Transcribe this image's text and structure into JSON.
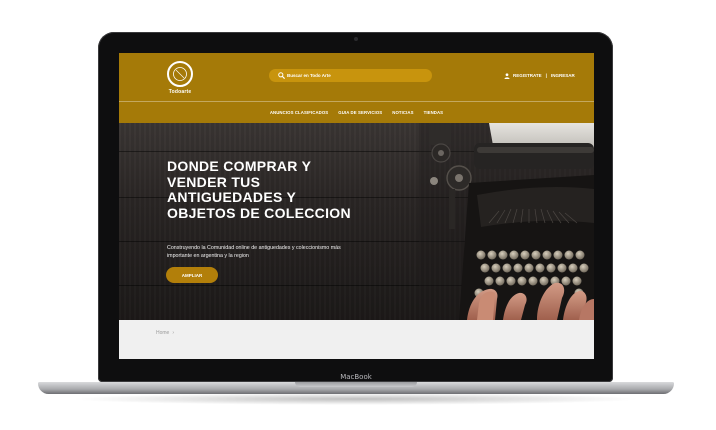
{
  "device": {
    "brand_label": "MacBook"
  },
  "header": {
    "logo_text": "Todoarte",
    "search_placeholder": "Buscar en Todo Arte",
    "register_label": "REGISTRATE",
    "separator": "|",
    "login_label": "INGRESAR",
    "accent_color": "#a57a08"
  },
  "nav": {
    "items": [
      {
        "label": "ANUNCIOS CLASIFICADOS"
      },
      {
        "label": "GUIA DE SERVICIOS"
      },
      {
        "label": "NOTICIAS"
      },
      {
        "label": "TIENDAS"
      }
    ]
  },
  "hero": {
    "title": "DONDE COMPRAR Y VENDER TUS ANTIGUEDADES Y OBJETOS DE COLECCION",
    "subtitle": "Construyendo la Comunidad online de antiguedades y coleccionismo más importante en argentina y la region",
    "cta_label": "AMPLIAR",
    "slides": 3,
    "active_slide": 1
  },
  "breadcrumb": {
    "home": "Home",
    "chevron": "›"
  },
  "icons": [
    "compass-logo-icon",
    "search-icon",
    "user-icon"
  ]
}
